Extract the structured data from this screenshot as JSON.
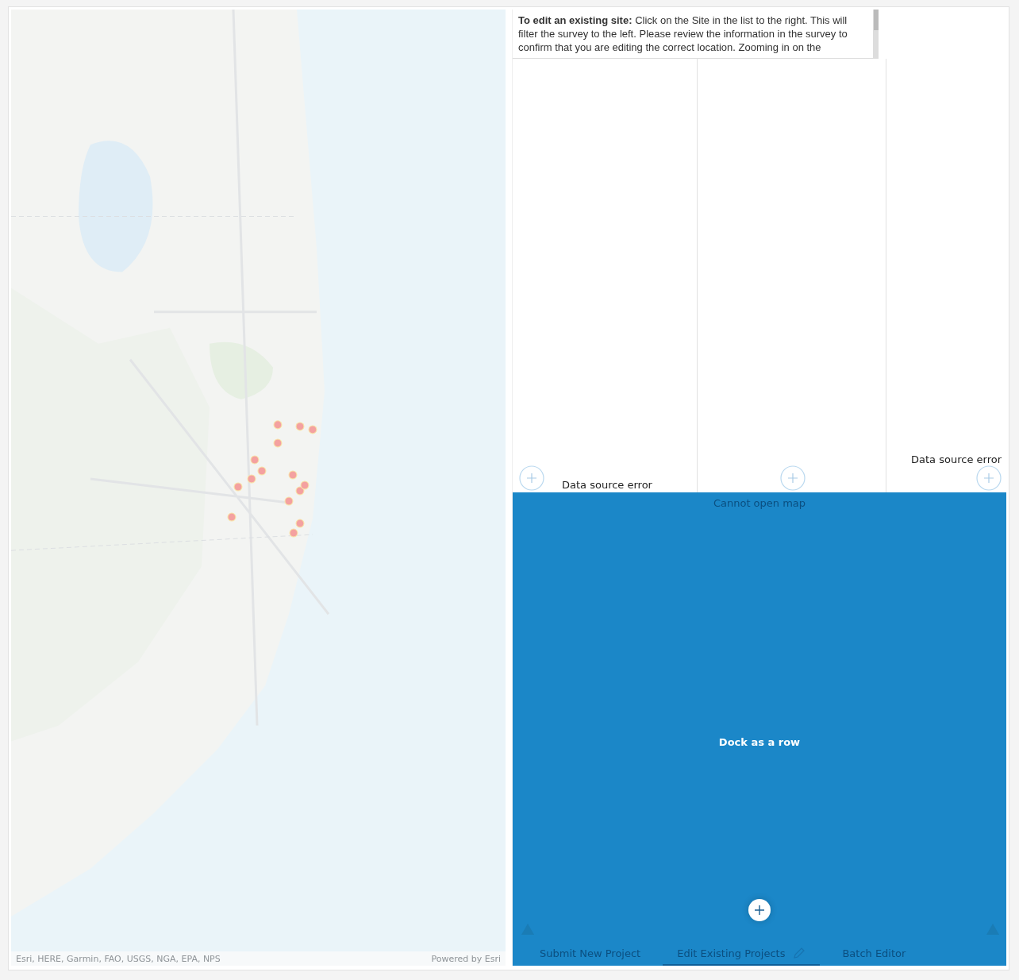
{
  "map": {
    "kind": "picture",
    "attribution": "Esri, HERE, Garmin, FAO, USGS, NGA, EPA, NPS",
    "powered_by": "Powered by Esri"
  },
  "instructions": {
    "text": "**To edit an existing site:** Click on the Site in the list to the right. This will filter the survey to the left. Please review the information in the survey to confirm that you are editing the correct location. Zooming in on the"
  },
  "columns": [
    {
      "message": "Data source error",
      "kind": "error-low"
    },
    {
      "message": "Cannot open map",
      "kind": "map-error"
    },
    {
      "message": "Data source error",
      "kind": "error-high"
    }
  ],
  "dock_overlay": {
    "label": "Dock as a row"
  },
  "tabs": [
    {
      "label": "Submit New Project",
      "selected": false,
      "editable": false
    },
    {
      "label": "Edit Existing Projects",
      "selected": true,
      "editable": true
    },
    {
      "label": "Batch Editor",
      "selected": false,
      "editable": false
    }
  ]
}
